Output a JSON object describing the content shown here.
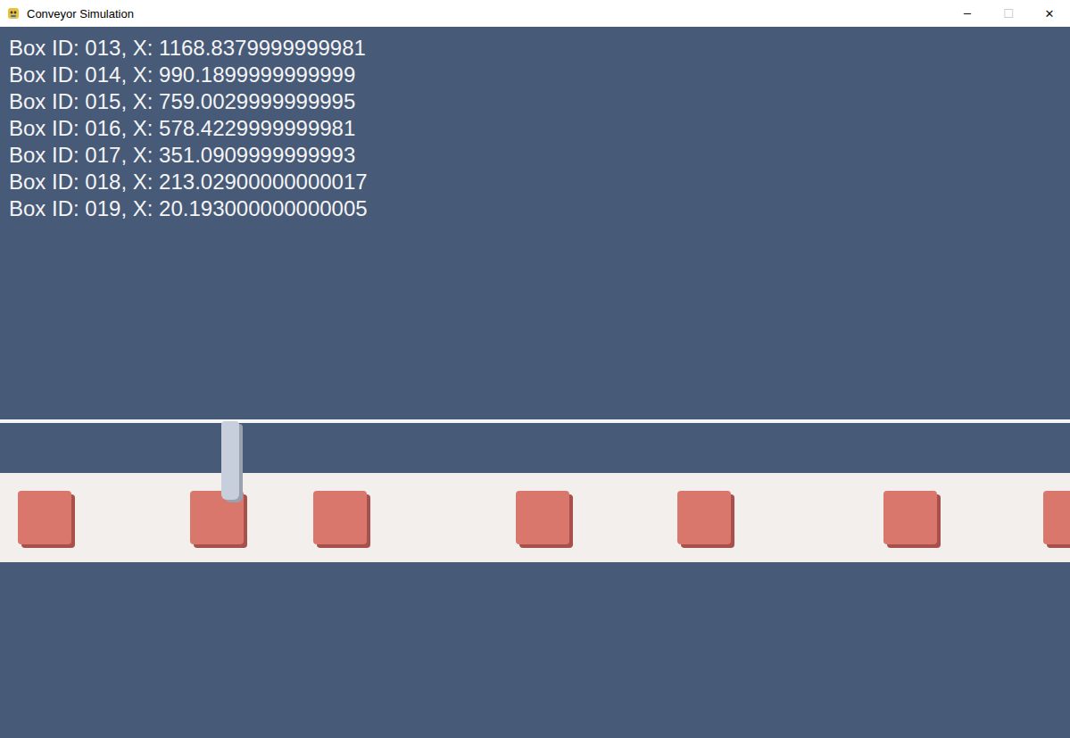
{
  "window": {
    "title": "Conveyor Simulation",
    "controls": [
      {
        "glyph": "─",
        "disabled": false
      },
      {
        "glyph": "☐",
        "disabled": true
      },
      {
        "glyph": "✕",
        "disabled": false
      }
    ]
  },
  "boxes": [
    {
      "label": "Box ID: 013, X: 1168.8379999999981"
    },
    {
      "label": "Box ID: 014, X: 990.1899999999999"
    },
    {
      "label": "Box ID: 015, X: 759.0029999999995"
    },
    {
      "label": "Box ID: 016, X: 578.4229999999981"
    },
    {
      "label": "Box ID: 017, X: 351.0909999999993"
    },
    {
      "label": "Box ID: 018, X: 213.02900000000017"
    },
    {
      "label": "Box ID: 019, X: 20.193000000000005"
    }
  ]
}
